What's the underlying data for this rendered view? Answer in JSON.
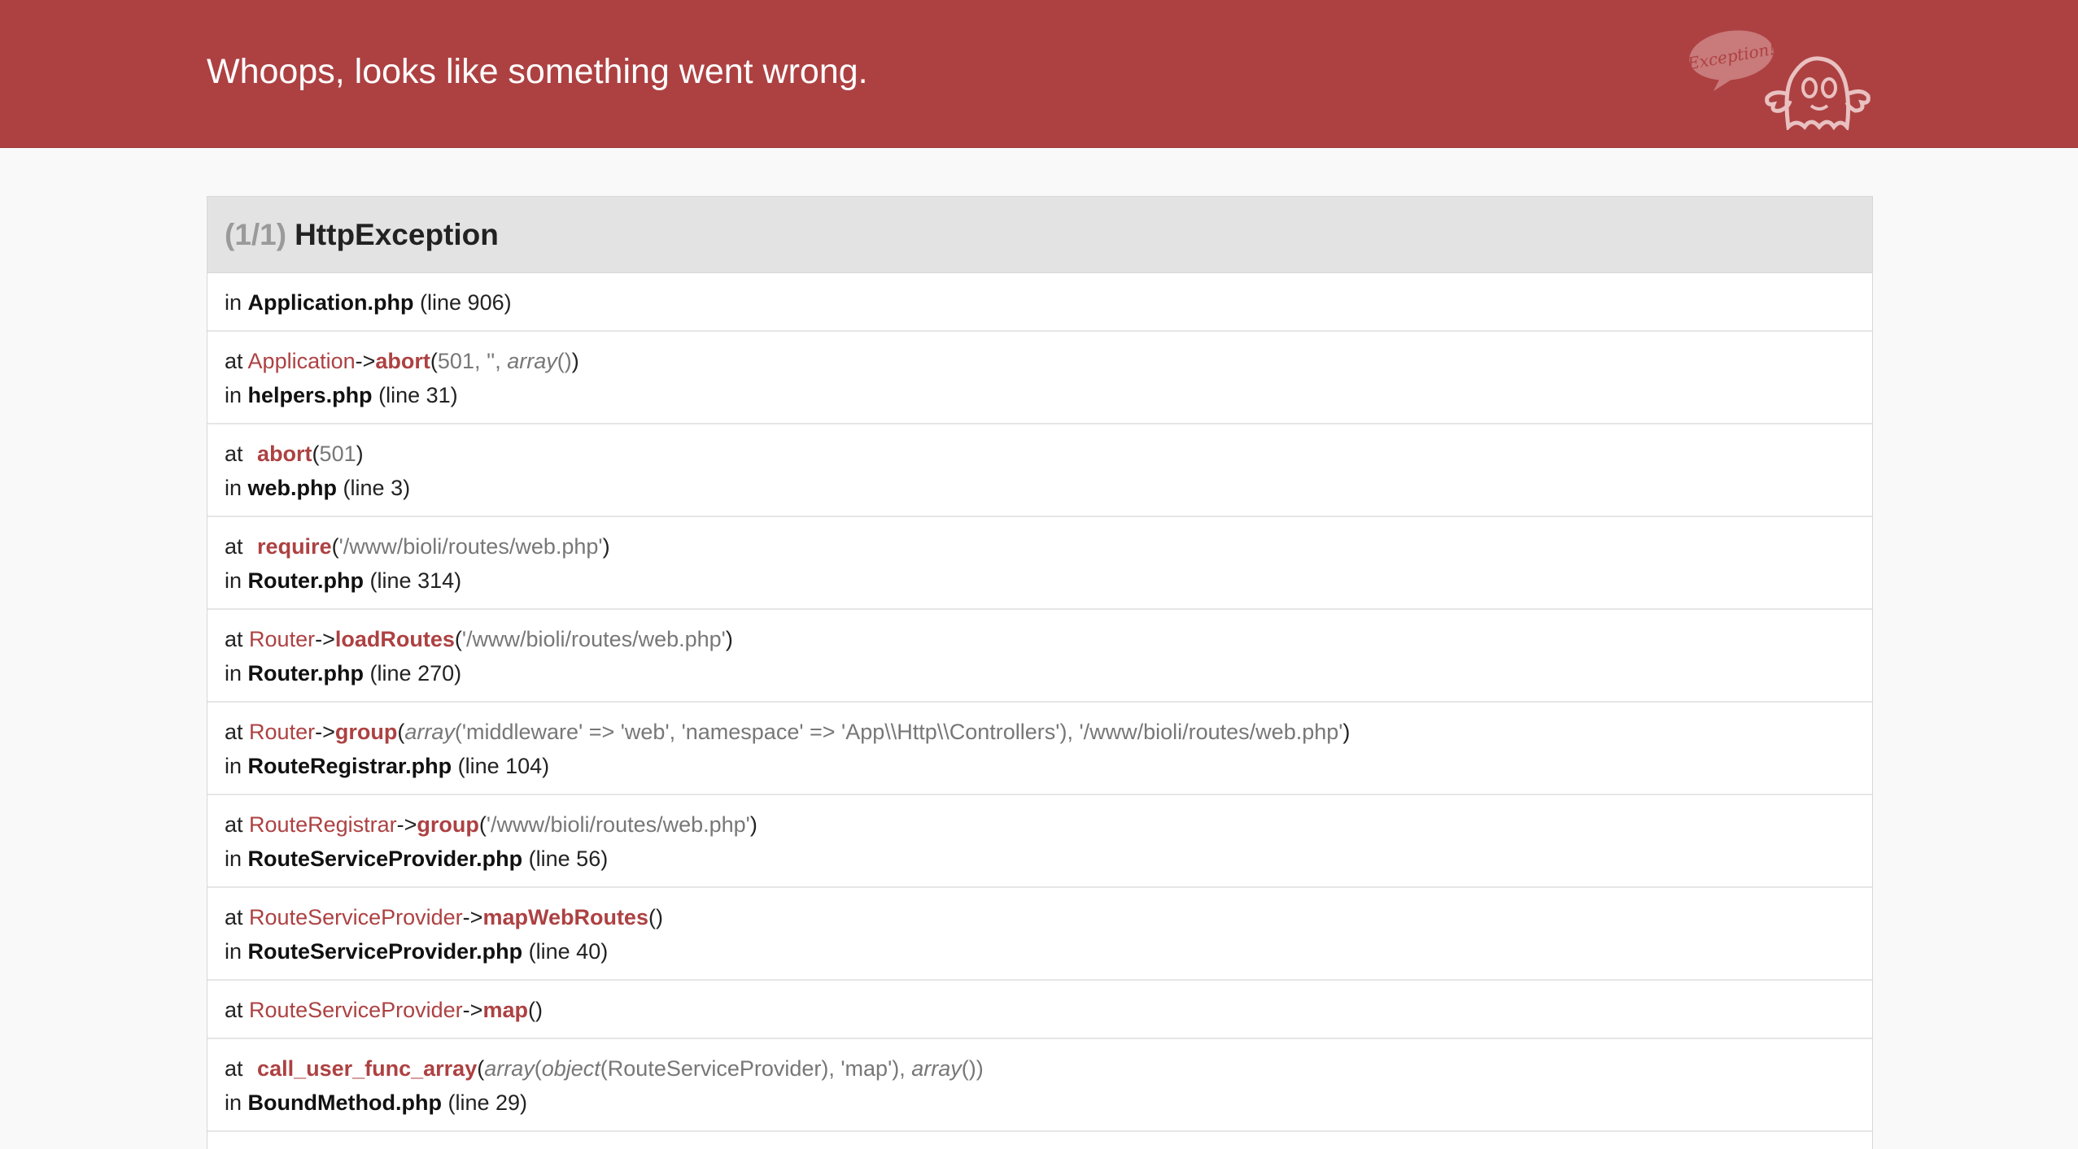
{
  "header": {
    "title": "Whoops, looks like something went wrong.",
    "logo_text": "Exception!"
  },
  "exception": {
    "counter": "(1/1)",
    "name": "HttpException"
  },
  "trace": {
    "r0": {
      "in_label": "in",
      "file": "Application.php",
      "line": "(line 906)"
    },
    "r1": {
      "at_label": "at",
      "cls": "Application",
      "arrow": "->",
      "fn": "abort",
      "open": "(",
      "a1": "501, '', ",
      "a1t": "array",
      "a1c": "()",
      "close": ")",
      "in_label": "in",
      "file": "helpers.php",
      "line": "(line 31)"
    },
    "r2": {
      "at_label": "at",
      "fn": "abort",
      "open": "(",
      "a1": "501",
      "close": ")",
      "in_label": "in",
      "file": "web.php",
      "line": "(line 3)"
    },
    "r3": {
      "at_label": "at",
      "fn": "require",
      "open": "(",
      "a1": "'/www/bioli/routes/web.php'",
      "close": ")",
      "in_label": "in",
      "file": "Router.php",
      "line": "(line 314)"
    },
    "r4": {
      "at_label": "at",
      "cls": "Router",
      "arrow": "->",
      "fn": "loadRoutes",
      "open": "(",
      "a1": "'/www/bioli/routes/web.php'",
      "close": ")",
      "in_label": "in",
      "file": "Router.php",
      "line": "(line 270)"
    },
    "r5": {
      "at_label": "at",
      "cls": "Router",
      "arrow": "->",
      "fn": "group",
      "open": "(",
      "a1t": "array",
      "a1": "('middleware' => 'web', 'namespace' => 'App\\\\Http\\\\Controllers'), '/www/bioli/routes/web.php'",
      "close": ")",
      "in_label": "in",
      "file": "RouteRegistrar.php",
      "line": "(line 104)"
    },
    "r6": {
      "at_label": "at",
      "cls": "RouteRegistrar",
      "arrow": "->",
      "fn": "group",
      "open": "(",
      "a1": "'/www/bioli/routes/web.php'",
      "close": ")",
      "in_label": "in",
      "file": "RouteServiceProvider.php",
      "line": "(line 56)"
    },
    "r7": {
      "at_label": "at",
      "cls": "RouteServiceProvider",
      "arrow": "->",
      "fn": "mapWebRoutes",
      "open": "(",
      "close": ")",
      "in_label": "in",
      "file": "RouteServiceProvider.php",
      "line": "(line 40)"
    },
    "r8": {
      "at_label": "at",
      "cls": "RouteServiceProvider",
      "arrow": "->",
      "fn": "map",
      "open": "(",
      "close": ")"
    },
    "r9": {
      "at_label": "at",
      "fn": "call_user_func_array",
      "open": "(",
      "a1t": "array",
      "a2t": "object",
      "a2": "(RouteServiceProvider), 'map'), ",
      "a3t": "array",
      "a3": "())",
      "close": ")",
      "in_label": "in",
      "file": "BoundMethod.php",
      "line": "(line 29)"
    }
  },
  "colors": {
    "header_bg": "#ad4142",
    "accent": "#ad4142",
    "panel_head_bg": "#e3e3e3"
  }
}
